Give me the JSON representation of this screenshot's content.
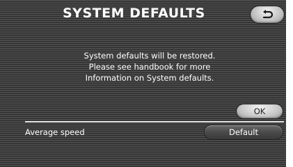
{
  "header": {
    "title": "SYSTEM DEFAULTS",
    "back_icon": "back-arrow-icon"
  },
  "message": {
    "lines": [
      "System defaults will be restored.",
      "Please see handbook for more",
      "Information on System defaults."
    ]
  },
  "buttons": {
    "ok_label": "OK",
    "default_label": "Default"
  },
  "settings": {
    "average_speed_label": "Average speed"
  }
}
